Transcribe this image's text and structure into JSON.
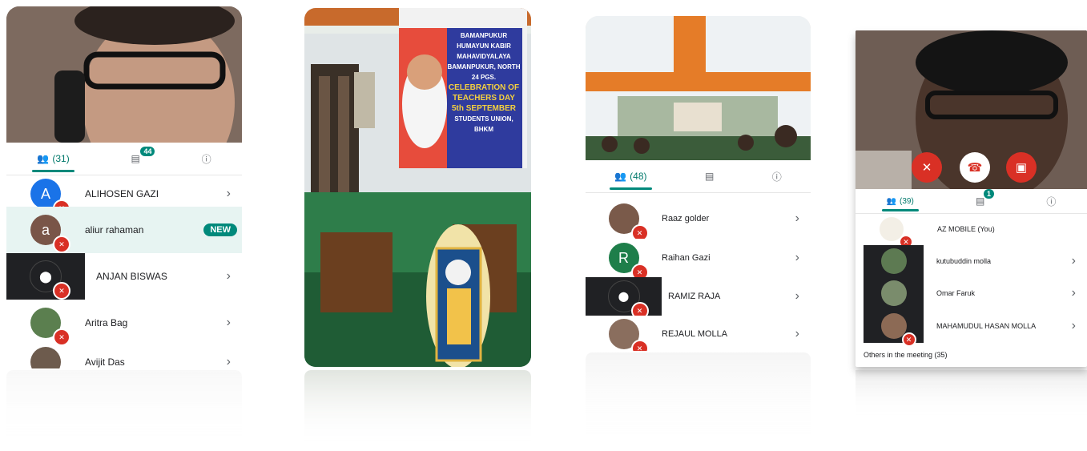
{
  "panel1": {
    "tabs": {
      "people_count": "(31)",
      "chat_badge": "44"
    },
    "participants": [
      {
        "initial": "A",
        "name": "ALIHOSEN GAZI",
        "avatar_color": "#1a73e8"
      },
      {
        "initial": "a",
        "name": "aliur rahaman",
        "badge": "NEW",
        "avatar_color": "#795548"
      },
      {
        "initial": "",
        "name": "ANJAN BISWAS",
        "avatar_color": "#202124"
      },
      {
        "initial": "",
        "name": "Aritra Bag",
        "avatar_color": "#5b7f4f"
      },
      {
        "initial": "",
        "name": "Avijit Das",
        "avatar_color": "#6d5b4d"
      }
    ]
  },
  "panel2": {
    "banner_lines": [
      "BAMANPUKUR HUMAYUN KABIR MAHAVIDYALAYA",
      "BAMANPUKUR, NORTH 24 PGS.",
      "CELEBRATION OF",
      "TEACHERS DAY",
      "5th SEPTEMBER",
      "STUDENTS UNION, BHKM"
    ]
  },
  "panel3": {
    "tabs": {
      "people_count": "(48)"
    },
    "participants": [
      {
        "initial": "",
        "name": "Raaz golder",
        "avatar_color": "#7a5a4a"
      },
      {
        "initial": "R",
        "name": "Raihan Gazi",
        "avatar_color": "#1e7e4a"
      },
      {
        "initial": "",
        "name": "RAMIZ RAJA",
        "avatar_color": "#202124"
      },
      {
        "initial": "",
        "name": "REJAUL MOLLA",
        "avatar_color": "#8a6e5e"
      }
    ]
  },
  "panel4": {
    "tabs": {
      "people_count": "(39)",
      "chat_badge": "1"
    },
    "participants": [
      {
        "name": "AZ MOBILE (You)"
      },
      {
        "name": "kutubuddin molla"
      },
      {
        "name": "Omar Faruk"
      },
      {
        "name": "MAHAMUDUL HASAN MOLLA"
      }
    ],
    "others": "Others in the meeting (35)"
  },
  "colors": {
    "accent": "#00897b",
    "mute": "#d93025"
  },
  "icons": [
    "people-icon",
    "chat-icon",
    "info-icon",
    "mic-off-icon",
    "chevron-right-icon",
    "pin-icon",
    "hangup-icon",
    "camera-off-icon"
  ]
}
